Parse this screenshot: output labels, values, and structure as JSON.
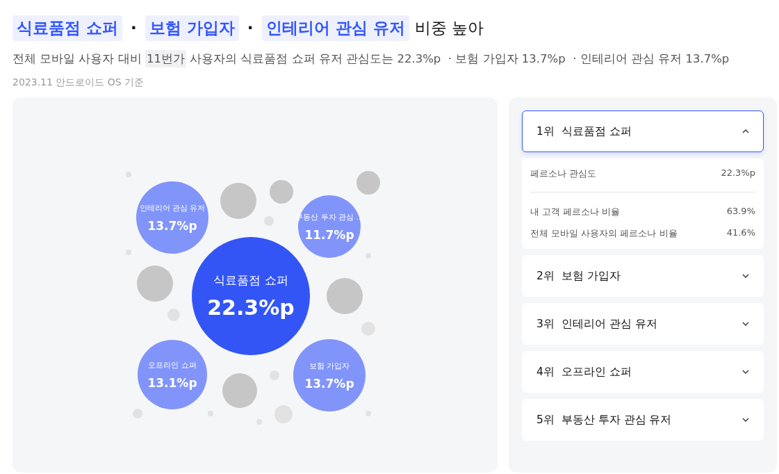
{
  "headline": [
    {
      "kind": "tag",
      "text": "식료품점 쇼퍼"
    },
    {
      "kind": "separator",
      "text": "·"
    },
    {
      "kind": "tag",
      "text": "보험 가입자"
    },
    {
      "kind": "separator",
      "text": "·"
    },
    {
      "kind": "tag",
      "text": "인테리어 관심 유저"
    },
    {
      "kind": "plain",
      "text": "비중 높아"
    }
  ],
  "summary": [
    {
      "text": "전체 모바일 사용자 대비 ",
      "highlight": false
    },
    {
      "text": "11번가",
      "highlight": true
    },
    {
      "text": " 사용자의 식료품점 쇼퍼 유저 관심도는 22.3%p  · 보험 가입자 13.7%p  · 인테리어 관심 유저 13.7%p",
      "highlight": false
    }
  ],
  "basis": "2023.11 안드로이드 OS 기준",
  "bubbles": [
    {
      "kind": "main",
      "label": "식료품점 쇼퍼",
      "value": "22.3%p"
    },
    {
      "kind": "sub",
      "label": "인테리어 관심 유저",
      "value": "13.7%p"
    },
    {
      "kind": "sub",
      "label": "부동산 투자 관심 ...",
      "value": "11.7%p"
    },
    {
      "kind": "sub",
      "label": "오프라인 쇼퍼",
      "value": "13.1%p"
    },
    {
      "kind": "sub",
      "label": "보험 가입자",
      "value": "13.7%p"
    }
  ],
  "ranking": [
    {
      "rank": "1위",
      "name": "식료품점 쇼퍼",
      "expanded": true,
      "details": {
        "primary": {
          "label": "페르소나 관심도",
          "value": "22.3%p"
        },
        "rows": [
          {
            "label": "내 고객 페르소나 비율",
            "value": "63.9%"
          },
          {
            "label": "전체 모바일 사용자의 페르소나 비율",
            "value": "41.6%"
          }
        ]
      }
    },
    {
      "rank": "2위",
      "name": "보험 가입자",
      "expanded": false
    },
    {
      "rank": "3위",
      "name": "인테리어 관심 유저",
      "expanded": false
    },
    {
      "rank": "4위",
      "name": "오프라인 쇼퍼",
      "expanded": false
    },
    {
      "rank": "5위",
      "name": "부동산 투자 관심 유저",
      "expanded": false
    }
  ]
}
